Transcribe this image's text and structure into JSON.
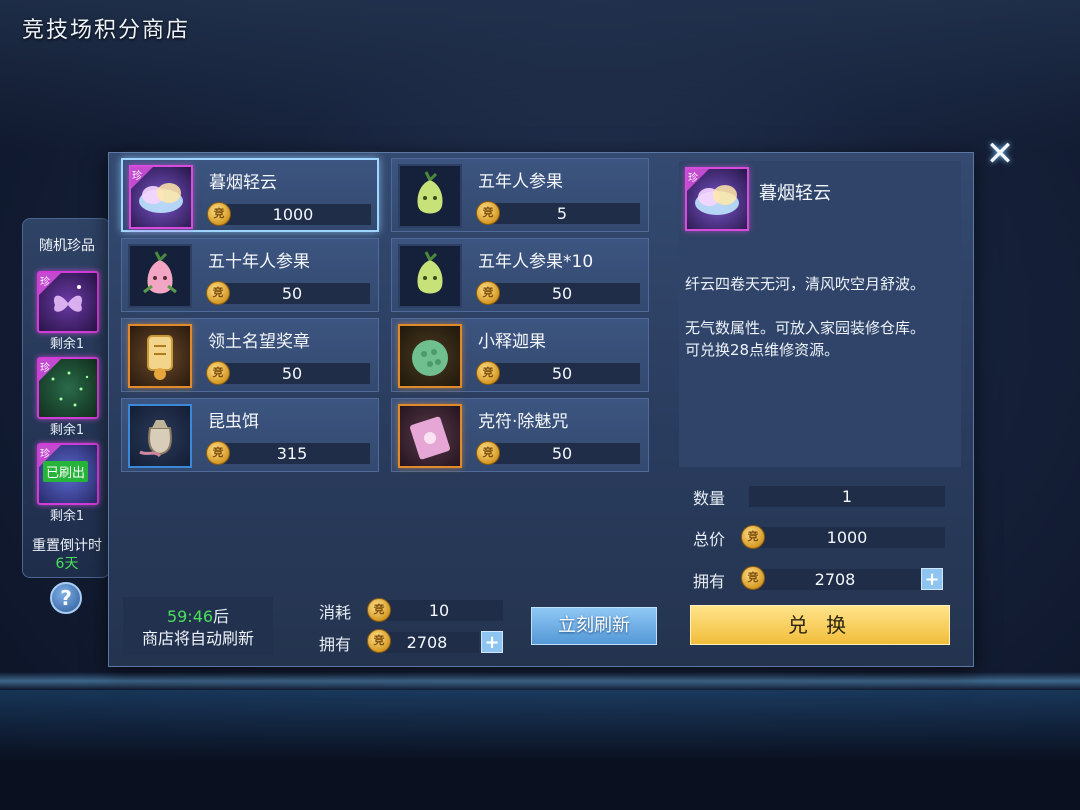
{
  "header": {
    "title": "竞技场积分商店"
  },
  "close": {
    "icon": "close-icon",
    "glyph": "✕"
  },
  "side": {
    "title": "随机珍品",
    "gem_label": "珍",
    "items": [
      {
        "remain": "剩余1",
        "refreshed": false
      },
      {
        "remain": "剩余1",
        "refreshed": false
      },
      {
        "remain": "剩余1",
        "refreshed": true
      }
    ],
    "refreshed_label": "已刷出",
    "reset_label": "重置倒计时",
    "reset_value": "6天",
    "help_label": "?"
  },
  "shop": {
    "coin_glyph": "竞",
    "items": [
      {
        "name": "暮烟轻云",
        "price": "1000",
        "rarity": "purple",
        "gem": true,
        "icon": "cloud-icon"
      },
      {
        "name": "五年人参果",
        "price": "5",
        "rarity": "none",
        "gem": false,
        "icon": "ginseng-fruit-icon"
      },
      {
        "name": "五十年人参果",
        "price": "50",
        "rarity": "none",
        "gem": false,
        "icon": "ginseng-fruit-pink-icon"
      },
      {
        "name": "五年人参果*10",
        "price": "50",
        "rarity": "none",
        "gem": false,
        "icon": "ginseng-fruit-icon"
      },
      {
        "name": "领土名望奖章",
        "price": "50",
        "rarity": "orange",
        "gem": false,
        "icon": "medal-icon"
      },
      {
        "name": "小释迦果",
        "price": "50",
        "rarity": "orange",
        "gem": false,
        "icon": "sugar-apple-icon"
      },
      {
        "name": "昆虫饵",
        "price": "315",
        "rarity": "blue",
        "gem": false,
        "icon": "bait-bag-icon"
      },
      {
        "name": "克符·除魅咒",
        "price": "50",
        "rarity": "orange",
        "gem": false,
        "icon": "talisman-icon"
      }
    ]
  },
  "refresh": {
    "timer": "59:46",
    "timer_suffix": "后",
    "note": "商店将自动刷新",
    "cost_label": "消耗",
    "cost_value": "10",
    "own_label": "拥有",
    "own_value": "2708",
    "plus": "+",
    "button": "立刻刷新"
  },
  "detail": {
    "name": "暮烟轻云",
    "gem_label": "珍",
    "desc1": "纤云四卷天无河，清风吹空月舒波。",
    "desc2": "无气数属性。可放入家园装修仓库。",
    "desc3": "可兑换28点维修资源。",
    "qty_label": "数量",
    "qty_value": "1",
    "total_label": "总价",
    "total_value": "1000",
    "own_label": "拥有",
    "own_value": "2708",
    "plus": "+",
    "exchange": "兑 换"
  },
  "colors": {
    "gem": "#c24bd0",
    "accent_green": "#49e05a",
    "exchange_gold": "#f1bd3a",
    "refresh_blue": "#5498d6"
  }
}
